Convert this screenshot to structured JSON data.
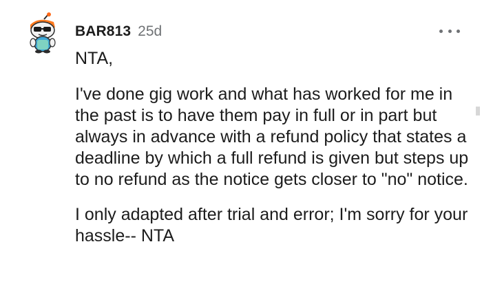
{
  "comment": {
    "author": "BAR813",
    "age": "25d",
    "avatar_icon": "snoo-avatar-icon",
    "more_icon": "more-options-icon",
    "paragraphs": [
      "NTA,",
      "I've done gig work and what has worked for me in the past is to have them pay in full or in part but always in advance with a refund policy that states a deadline by which a full refund is given but steps up to no refund as the notice gets closer to \"no\" notice.",
      "I only adapted after trial and error; I'm sorry for your hassle-- NTA"
    ]
  }
}
